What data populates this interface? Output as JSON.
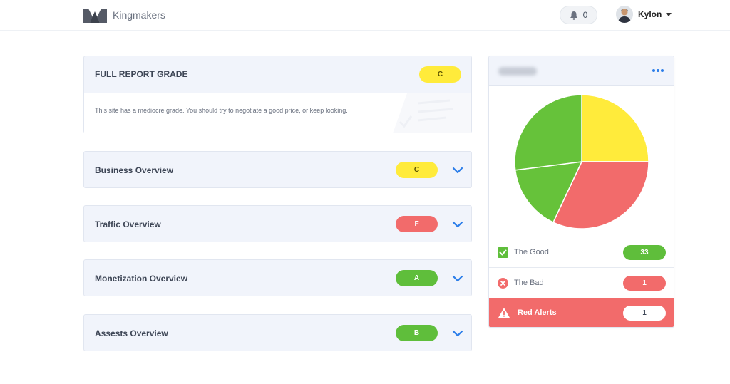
{
  "header": {
    "brand": "Kingmakers",
    "notifications_count": "0",
    "user_name": "Kylon"
  },
  "full_report": {
    "title": "FULL REPORT GRADE",
    "grade": "C",
    "description": "This site has a mediocre grade. You should try to negotiate a good price, or keep looking."
  },
  "sections": [
    {
      "title": "Business Overview",
      "grade": "C"
    },
    {
      "title": "Traffic Overview",
      "grade": "F"
    },
    {
      "title": "Monetization Overview",
      "grade": "A"
    },
    {
      "title": "Assests Overview",
      "grade": "B"
    }
  ],
  "colors": {
    "grade_c": "#ffeb3b",
    "grade_f": "#f26b6b",
    "grade_a": "#5fbe3b",
    "grade_b": "#5fbe3b",
    "accent": "#2b7de9",
    "pie_yellow": "#ffeb3b",
    "pie_red": "#f26b6b",
    "pie_green": "#66c23a"
  },
  "panel": {
    "icons": [
      "more-dots-icon",
      "check-icon",
      "x-circle-icon",
      "warning-icon"
    ],
    "rows": [
      {
        "label": "The Good",
        "count": "33"
      },
      {
        "label": "The Bad",
        "count": "1"
      },
      {
        "label": "Red Alerts",
        "count": "1"
      }
    ]
  },
  "chart_data": {
    "type": "pie",
    "slices": [
      {
        "value": 25,
        "color": "#ffeb3b"
      },
      {
        "value": 32,
        "color": "#f26b6b"
      },
      {
        "value": 16,
        "color": "#66c23a"
      },
      {
        "value": 27,
        "color": "#66c23a"
      }
    ]
  }
}
